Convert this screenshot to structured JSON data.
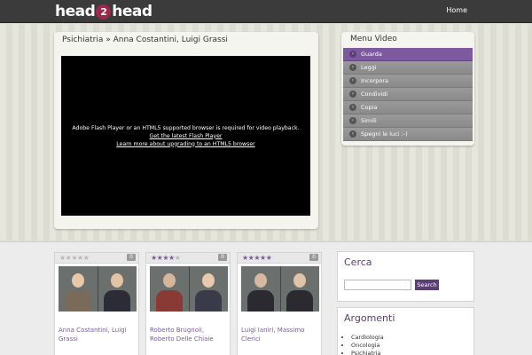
{
  "header": {
    "logo_left": "head",
    "logo_mark": "2",
    "logo_right": "head",
    "nav_home": "Home"
  },
  "video": {
    "breadcrumb": "Psichiatria » Anna Costantini, Luigi Grassi",
    "player_message": "Adobe Flash Player or an HTML5 supported browser is required for video playback.",
    "player_link_flash": "Get the latest Flash Player",
    "player_link_html5": "Learn more about upgrading to an HTML5 browser"
  },
  "menu": {
    "title": "Menu Video",
    "items": [
      {
        "label": "Guarda",
        "active": true
      },
      {
        "label": "Leggi",
        "active": false
      },
      {
        "label": "Incorpora",
        "active": false
      },
      {
        "label": "Condividi",
        "active": false
      },
      {
        "label": "Copia",
        "active": false
      },
      {
        "label": "Simili",
        "active": false
      },
      {
        "label": "Spegni le luci :-)",
        "active": false
      }
    ]
  },
  "cards": [
    {
      "names": "Anna Costantini, Luigi Grassi",
      "stars": 0,
      "count": "0",
      "view_label": "view"
    },
    {
      "names": "Roberto Brugnoli, Roberto Delle Chiaie",
      "stars": 4,
      "count": "0",
      "view_label": "view"
    },
    {
      "names": "Luigi Ianiri, Massimo Clerici",
      "stars": 4.5,
      "count": "0",
      "view_label": "view"
    }
  ],
  "search": {
    "title": "Cerca",
    "button_label": "Search",
    "placeholder": ""
  },
  "topics": {
    "title": "Argomenti",
    "items": [
      "Cardiologia",
      "Oncologia",
      "Psichiatria"
    ]
  },
  "colors": {
    "accent": "#7d5aa0",
    "accent_dark": "#5a3f73",
    "header_bg": "#3b3b3b"
  }
}
